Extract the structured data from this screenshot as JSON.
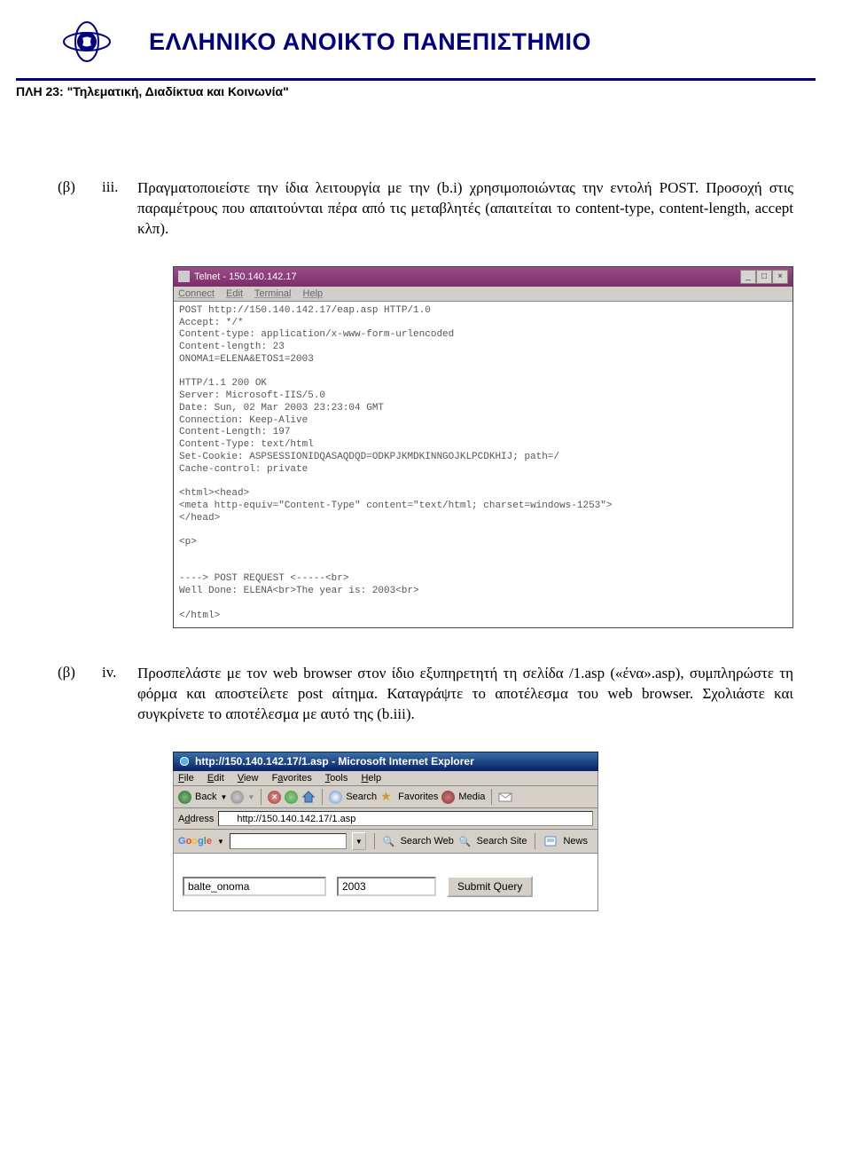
{
  "header": {
    "university": "ΕΛΛΗΝΙΚΟ ΑΝΟΙΚΤΟ ΠΑΝΕΠΙΣΤΗΜΙΟ",
    "course": "ΠΛΗ 23: \"Τηλεματική, Διαδίκτυα και Κοινωνία\""
  },
  "item1": {
    "marker_a": "(β)",
    "marker_b": "iii.",
    "text": "Πραγματοποιείστε την ίδια λειτουργία με την (b.i) χρησιμοποιώντας την εντολή POST. Προσοχή στις παραμέτρους που απαιτούνται πέρα από τις μεταβλητές (απαιτείται το content-type, content-length, accept κλπ)."
  },
  "telnet": {
    "title": "Telnet - 150.140.142.17",
    "menu": {
      "connect": "Connect",
      "edit": "Edit",
      "terminal": "Terminal",
      "help": "Help"
    },
    "body": "POST http://150.140.142.17/eap.asp HTTP/1.0\nAccept: */*\nContent-type: application/x-www-form-urlencoded\nContent-length: 23\nONOMA1=ELENA&ETOS1=2003\n\nHTTP/1.1 200 OK\nServer: Microsoft-IIS/5.0\nDate: Sun, 02 Mar 2003 23:23:04 GMT\nConnection: Keep-Alive\nContent-Length: 197\nContent-Type: text/html\nSet-Cookie: ASPSESSIONIDQASAQDQD=ODKPJKMDKINNGOJKLPCDKHIJ; path=/\nCache-control: private\n\n<html><head>\n<meta http-equiv=\"Content-Type\" content=\"text/html; charset=windows-1253\">\n</head>\n\n<p>\n\n\n----> POST REQUEST <-----<br>\nWell Done: ELENA<br>The year is: 2003<br>\n\n</html>"
  },
  "item2": {
    "marker_a": "(β)",
    "marker_b": "iv.",
    "text": "Προσπελάστε με τον web browser στον ίδιο εξυπηρετητή τη σελίδα /1.asp («ένα».asp), συμπληρώστε τη φόρμα και αποστείλετε post αίτημα. Καταγράψτε το αποτέλεσμα του web browser. Σχολιάστε και συγκρίνετε το αποτέλεσμα με αυτό της (b.iii)."
  },
  "ie": {
    "title": "http://150.140.142.17/1.asp - Microsoft Internet Explorer",
    "menu": {
      "file": "File",
      "edit": "Edit",
      "view": "View",
      "favorites": "Favorites",
      "tools": "Tools",
      "help": "Help"
    },
    "toolbar": {
      "back": "Back",
      "search": "Search",
      "favorites": "Favorites",
      "media": "Media"
    },
    "address_label": "Address",
    "address_value": "http://150.140.142.17/1.asp",
    "google": {
      "searchweb": "Search Web",
      "searchsite": "Search Site",
      "news": "News"
    },
    "form": {
      "input1": "balte_onoma",
      "input2": "2003",
      "submit": "Submit Query"
    }
  }
}
